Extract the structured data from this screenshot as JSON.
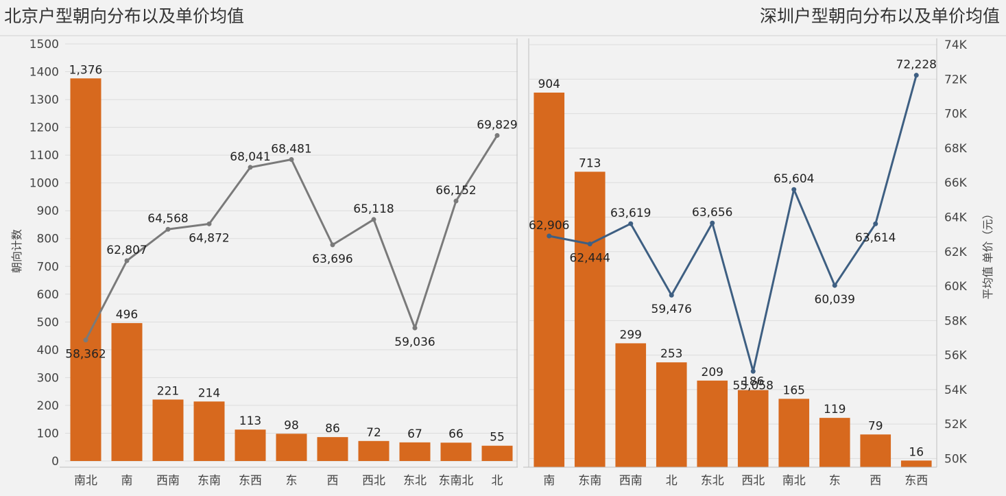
{
  "chart_data": [
    {
      "type": "bar",
      "title": "北京户型朝向分布以及单价均值",
      "ylabel": "朝向计数",
      "ylim": [
        0,
        1500
      ],
      "yticks": [
        0,
        100,
        200,
        300,
        400,
        500,
        600,
        700,
        800,
        900,
        1000,
        1100,
        1200,
        1300,
        1400,
        1500
      ],
      "y2lim": [
        56000,
        72000
      ],
      "categories": [
        "南北",
        "南",
        "西南",
        "东南",
        "东西",
        "东",
        "西",
        "西北",
        "东北",
        "东南北",
        "北"
      ],
      "series": [
        {
          "type": "bar",
          "axis": "left",
          "values": [
            1376,
            496,
            221,
            214,
            113,
            98,
            86,
            72,
            67,
            66,
            55
          ],
          "labels": [
            "1,376",
            "496",
            "221",
            "214",
            "113",
            "98",
            "86",
            "72",
            "67",
            "66",
            "55"
          ]
        },
        {
          "type": "line",
          "axis": "right",
          "values": [
            58362,
            62807,
            64568,
            64872,
            68041,
            68481,
            63696,
            65118,
            59036,
            66152,
            69829
          ],
          "labels": [
            "58,362",
            "62,807",
            "64,568",
            "64,872",
            "68,041",
            "68,481",
            "63,696",
            "65,118",
            "59,036",
            "66,152",
            "69,829"
          ]
        }
      ],
      "grid": true,
      "colors": {
        "bar": "#d7691e",
        "line": "#7a7a7a"
      }
    },
    {
      "type": "bar",
      "title": "深圳户型朝向分布以及单价均值",
      "ylabel": "平均值 单价（元）",
      "ylim": [
        0,
        1000
      ],
      "y2lim": [
        49500,
        75000
      ],
      "y2ticks": [
        50000,
        52000,
        54000,
        56000,
        58000,
        60000,
        62000,
        64000,
        66000,
        68000,
        70000,
        72000,
        74000
      ],
      "y2ticklabels": [
        "50K",
        "52K",
        "54K",
        "56K",
        "58K",
        "60K",
        "62K",
        "64K",
        "66K",
        "68K",
        "70K",
        "72K",
        "74K"
      ],
      "categories": [
        "南",
        "东南",
        "西南",
        "北",
        "东北",
        "西北",
        "南北",
        "东",
        "西",
        "东西"
      ],
      "series": [
        {
          "type": "bar",
          "axis": "left",
          "values": [
            904,
            713,
            299,
            253,
            209,
            186,
            165,
            119,
            79,
            16
          ],
          "labels": [
            "904",
            "713",
            "299",
            "253",
            "209",
            "186",
            "165",
            "119",
            "79",
            "16"
          ]
        },
        {
          "type": "line",
          "axis": "right",
          "values": [
            62906,
            62444,
            63619,
            59476,
            63656,
            55058,
            65604,
            60039,
            63614,
            72228
          ],
          "labels": [
            "62,906",
            "62,444",
            "63,619",
            "59,476",
            "63,656",
            "55,058",
            "65,604",
            "60,039",
            "63,614",
            "72,228"
          ]
        }
      ],
      "grid": true,
      "colors": {
        "bar": "#d7691e",
        "line": "#3e5f82"
      }
    }
  ]
}
